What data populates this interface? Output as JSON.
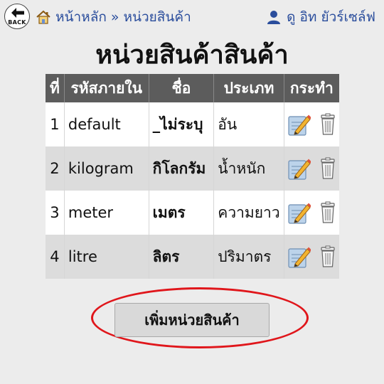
{
  "nav": {
    "back_label": "BACK",
    "home_label": "หน้าหลัก",
    "separator": "»",
    "current_label": "หน่วยสินค้า",
    "user_name": "ดู อิท ยัวร์เซล์ฟ"
  },
  "page": {
    "title": "หน่วยสินค้าสินค้า"
  },
  "table": {
    "headers": {
      "index": "ที่",
      "code": "รหัสภายใน",
      "name": "ชื่อ",
      "type": "ประเภท",
      "actions": "กระทำ"
    },
    "rows": [
      {
        "index": "1",
        "code": "default",
        "name": "_ไม่ระบุ",
        "type": "อัน"
      },
      {
        "index": "2",
        "code": "kilogram",
        "name": "กิโลกรัม",
        "type": "น้ำหนัก"
      },
      {
        "index": "3",
        "code": "meter",
        "name": "เมตร",
        "type": "ความยาว"
      },
      {
        "index": "4",
        "code": "litre",
        "name": "ลิตร",
        "type": "ปริมาตร"
      }
    ]
  },
  "add_button_label": "เพิ่มหน่วยสินค้า",
  "icons": {
    "back": "arrow-left-icon",
    "home": "home-icon",
    "user": "user-icon",
    "edit": "edit-icon",
    "delete": "trash-icon"
  },
  "colors": {
    "link": "#2a4d9c",
    "header_bg": "#5c5c5c",
    "highlight_oval": "#e0161b"
  }
}
